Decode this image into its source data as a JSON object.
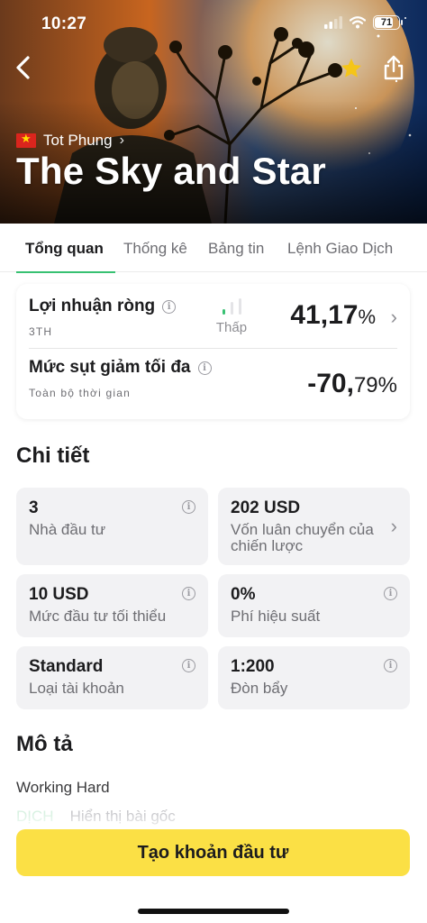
{
  "status_bar": {
    "time": "10:27",
    "battery": "71"
  },
  "header": {
    "owner": "Tot Phung",
    "title": "The Sky and Star"
  },
  "tabs": [
    {
      "label": "Tổng quan",
      "active": true
    },
    {
      "label": "Thống kê",
      "active": false
    },
    {
      "label": "Bảng tin",
      "active": false
    },
    {
      "label": "Lệnh Giao Dịch",
      "active": false
    }
  ],
  "summary": {
    "net_profit": {
      "label": "Lợi nhuận ròng",
      "period": "3TH",
      "risk_label": "Thấp",
      "risk_level_bars_filled": 1,
      "value_int": "41,17",
      "value_unit": "%"
    },
    "max_drawdown": {
      "label": "Mức sụt giảm tối đa",
      "period": "Toàn bộ thời gian",
      "value_int": "-70,",
      "value_dec": "79%"
    }
  },
  "details": {
    "title": "Chi tiết",
    "tiles": [
      {
        "value": "3",
        "label": "Nhà đầu tư"
      },
      {
        "value": "202 USD",
        "label": "Vốn luân chuyển của chiến lược"
      },
      {
        "value": "10 USD",
        "label": "Mức đầu tư tối thiểu"
      },
      {
        "value": "0%",
        "label": "Phí hiệu suất"
      },
      {
        "value": "Standard",
        "label": "Loại tài khoản"
      },
      {
        "value": "1:200",
        "label": "Đòn bẩy"
      }
    ]
  },
  "description": {
    "title": "Mô tả",
    "text": "Working Hard",
    "translate": "DỊCH",
    "show_original": "Hiển thị bài gốc"
  },
  "cta": {
    "label": "Tạo khoản đầu tư"
  },
  "colors": {
    "accent_green": "#38c172",
    "cta_yellow": "#fbe045",
    "star": "#f5c518"
  },
  "icons": [
    "back-arrow-icon",
    "star-icon",
    "share-icon",
    "vn-flag-icon",
    "chevron-right-icon",
    "info-icon",
    "signal-icon",
    "wifi-icon",
    "battery-icon"
  ]
}
